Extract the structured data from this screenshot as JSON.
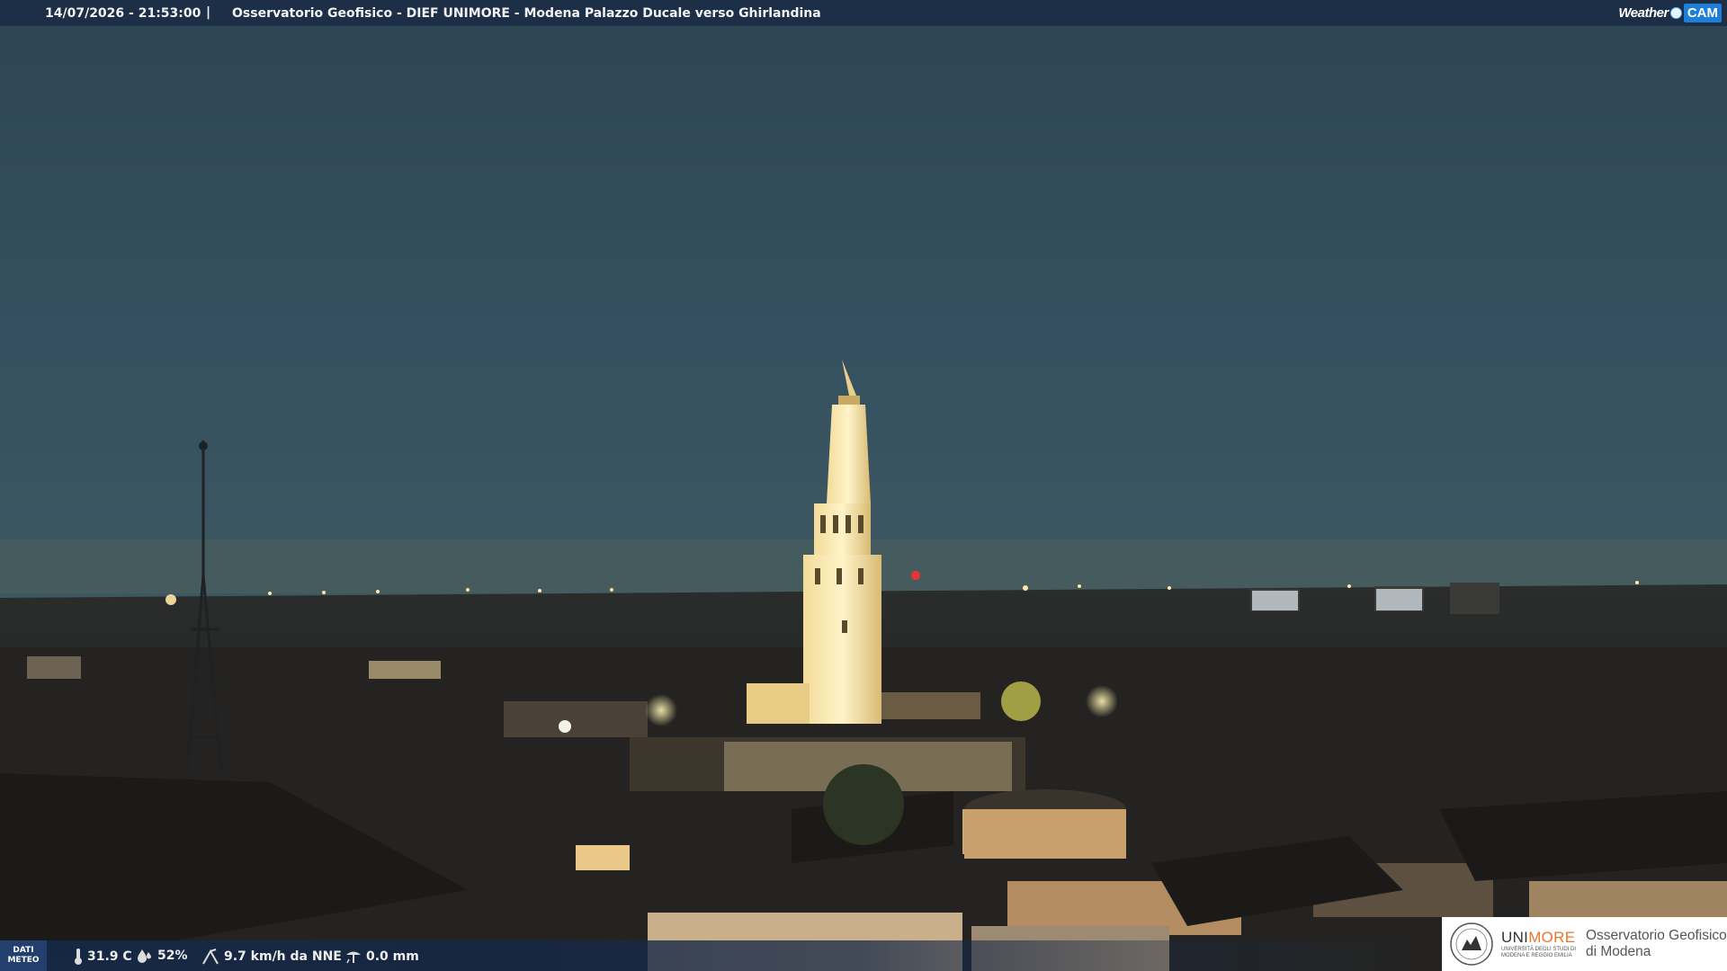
{
  "header": {
    "timestamp": "14/07/2026 - 21:53:00",
    "separator": "|",
    "camera_title": "Osservatorio Geofisico - DIEF UNIMORE - Modena Palazzo Ducale verso Ghirlandina"
  },
  "brand": {
    "part1": "Weather",
    "part2": "CAM"
  },
  "weather": {
    "label_line1": "DATI",
    "label_line2": "METEO",
    "temperature": "31.9 C",
    "humidity": "52%",
    "wind": "9.7 km/h da NNE",
    "rain": "0.0 mm"
  },
  "institution": {
    "name_part1": "UNI",
    "name_part2": "MORE",
    "subtitle": "UNIVERSITÀ DEGLI STUDI DI MODENA E REGGIO EMILIA",
    "observatory_line1": "Osservatorio Geofisico",
    "observatory_line2": "di Modena"
  },
  "icons": [
    "thermometer-icon",
    "humidity-drop-icon",
    "wind-icon",
    "rain-gauge-icon",
    "unimore-seal-icon",
    "weathercam-dot-icon"
  ]
}
